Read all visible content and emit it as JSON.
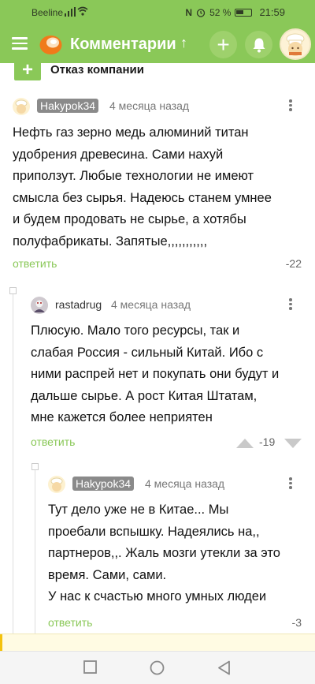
{
  "status_bar": {
    "carrier": "Beeline",
    "nfc": "N",
    "battery": "52 %",
    "time": "21:59"
  },
  "app_bar": {
    "title": "Комментарии",
    "sort_arrow": "↑",
    "add_label": "+"
  },
  "parent_post": {
    "expand_label": "+",
    "title": "Отказ компании"
  },
  "comments": [
    {
      "author": "Hakypok34",
      "time": "4 месяца назад",
      "lines": [
        "Нефть газ зерно медь алюминий титан",
        "удобрения древесина. Сами нахуй",
        "приползут. Любые технологии не имеют",
        "смысла без сырья. Надеюсь станем умнее",
        "и будем продовать не сырье, а хотябы",
        "полуфабрикаты. Запятые,,,,,,,,,,,"
      ],
      "reply_label": "ответить",
      "score": "-22"
    },
    {
      "author": "rastadrug",
      "time": "4 месяца назад",
      "lines": [
        "Плюсую. Мало того ресурсы, так и",
        "слабая Россия - сильный Китай. Ибо с",
        "ними распрей нет и покупать они будут и",
        "дальше сырье. А рост Китая Штатам,",
        "мне кажется более неприятен"
      ],
      "reply_label": "ответить",
      "score": "-19"
    },
    {
      "author": "Hakypok34",
      "time": "4 месяца назад",
      "lines": [
        "Тут дело уже не в Китае... Мы",
        "проебали вспышку. Надеялись на,,",
        "партнеров,,. Жаль мозги утекли за это",
        "время. Сами, сами.",
        "У нас к счастью много умных людеи"
      ],
      "reply_label": "ответить",
      "score": "-3"
    }
  ],
  "colors": {
    "accent": "#8ac858",
    "accent_light": "#9ed16c",
    "badge": "#8a8a8a",
    "draft": "#fffbe3"
  },
  "icons": [
    "menu-icon",
    "pikabu-logo-icon",
    "plus-icon",
    "bell-icon",
    "kebab-icon",
    "upvote-icon",
    "downvote-icon",
    "back-icon",
    "home-icon",
    "recents-icon"
  ]
}
